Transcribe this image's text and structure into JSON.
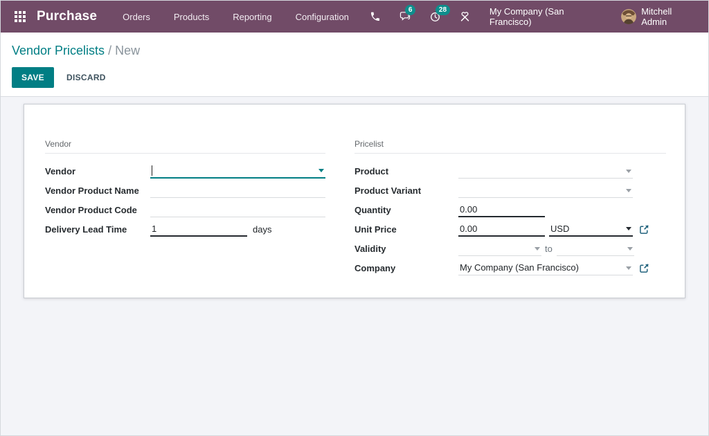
{
  "navbar": {
    "app_name": "Purchase",
    "menu": [
      "Orders",
      "Products",
      "Reporting",
      "Configuration"
    ],
    "messages_badge": "6",
    "activities_badge": "28",
    "company": "My Company (San Francisco)",
    "user_name": "Mitchell Admin"
  },
  "breadcrumb": {
    "parent": "Vendor Pricelists",
    "separator": "/",
    "current": "New"
  },
  "actions": {
    "save": "SAVE",
    "discard": "DISCARD"
  },
  "form": {
    "vendor_group": {
      "title": "Vendor",
      "vendor": {
        "label": "Vendor",
        "value": ""
      },
      "vendor_product_name": {
        "label": "Vendor Product Name",
        "value": ""
      },
      "vendor_product_code": {
        "label": "Vendor Product Code",
        "value": ""
      },
      "delivery_lead_time": {
        "label": "Delivery Lead Time",
        "value": "1",
        "unit": "days"
      }
    },
    "pricelist_group": {
      "title": "Pricelist",
      "product": {
        "label": "Product",
        "value": ""
      },
      "product_variant": {
        "label": "Product Variant",
        "value": ""
      },
      "quantity": {
        "label": "Quantity",
        "value": "0.00"
      },
      "unit_price": {
        "label": "Unit Price",
        "value": "0.00",
        "currency": "USD"
      },
      "validity": {
        "label": "Validity",
        "start": "",
        "separator": "to",
        "end": ""
      },
      "company": {
        "label": "Company",
        "value": "My Company (San Francisco)"
      }
    }
  },
  "colors": {
    "navbar_bg": "#714B67",
    "accent_teal": "#017E84",
    "badge_teal": "#0E8E8C",
    "external_link_blue": "#20627C",
    "content_bg": "#F3F4F8"
  }
}
